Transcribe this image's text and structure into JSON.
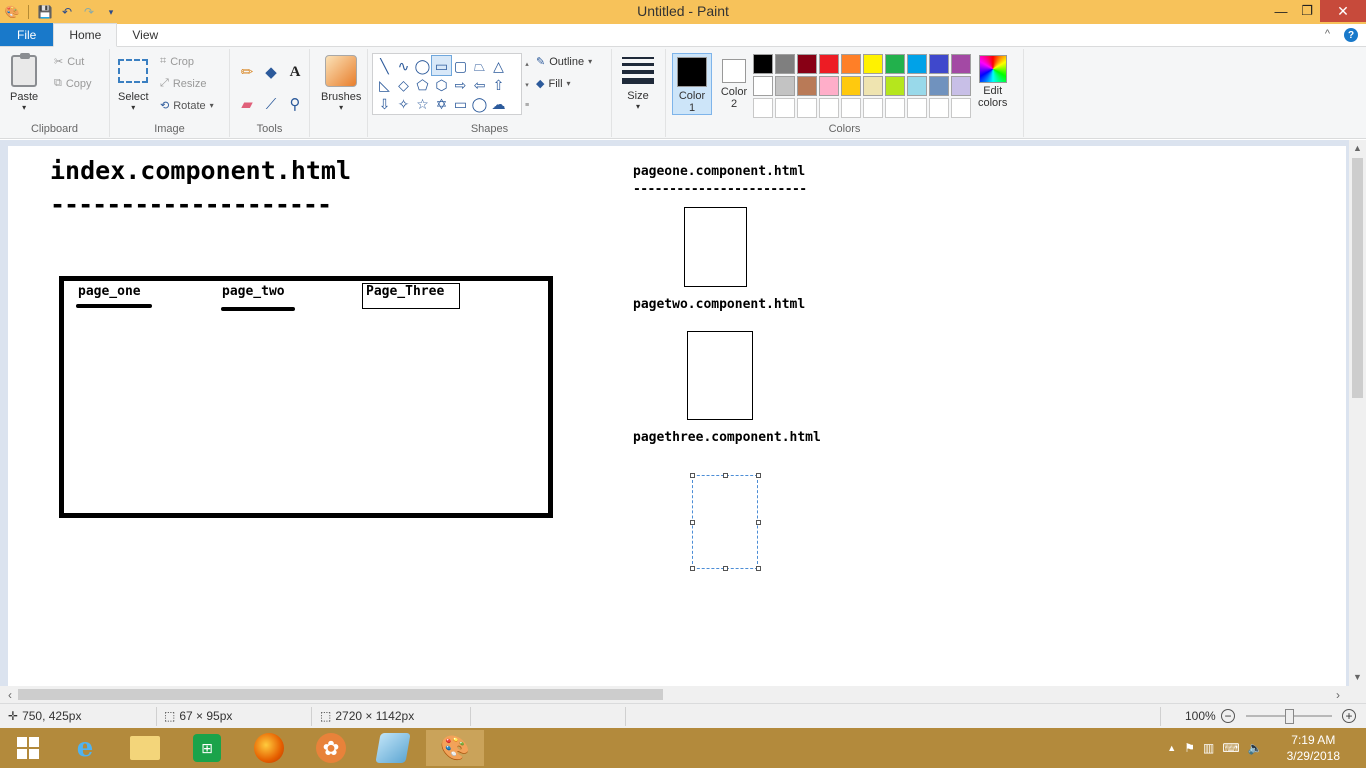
{
  "window": {
    "title": "Untitled - Paint",
    "minimize": "—",
    "maximize": "❐",
    "close": "✕"
  },
  "tabs": {
    "file": "File",
    "home": "Home",
    "view": "View",
    "collapse": "^",
    "help": "?"
  },
  "ribbon": {
    "clipboard": {
      "label": "Clipboard",
      "paste": "Paste",
      "cut": "Cut",
      "copy": "Copy"
    },
    "image": {
      "label": "Image",
      "select": "Select",
      "crop": "Crop",
      "resize": "Resize",
      "rotate": "Rotate"
    },
    "tools": {
      "label": "Tools"
    },
    "brushes": "Brushes",
    "shapes": {
      "label": "Shapes",
      "outline": "Outline",
      "fill": "Fill"
    },
    "size": "Size",
    "colors": {
      "label": "Colors",
      "color1": "Color",
      "color1_num": "1",
      "color2": "Color",
      "color2_num": "2",
      "edit_line1": "Edit",
      "edit_line2": "colors",
      "color1_value": "#000000",
      "color2_value": "#ffffff",
      "palette": [
        "#000000",
        "#7f7f7f",
        "#880015",
        "#ed1c24",
        "#ff7f27",
        "#fff200",
        "#22b14c",
        "#00a2e8",
        "#3f48cc",
        "#a349a4",
        "#ffffff",
        "#c3c3c3",
        "#b97a57",
        "#ffaec9",
        "#ffc90e",
        "#efe4b0",
        "#b5e61d",
        "#99d9ea",
        "#7092be",
        "#c8bfe7",
        "#ffffff",
        "#ffffff",
        "#ffffff",
        "#ffffff",
        "#ffffff",
        "#ffffff",
        "#ffffff",
        "#ffffff",
        "#ffffff",
        "#ffffff"
      ]
    }
  },
  "canvas": {
    "index_title": "index.component.html",
    "index_dashes": "--------------------",
    "page_one_link": "page_one",
    "page_two_link": "page_two",
    "page_three_link": "Page_Three",
    "pageone_label": "pageone.component.html",
    "pageone_dashes": "------------------------",
    "pagetwo_label": "pagetwo.component.html",
    "pagethree_label": "pagethree.component.html"
  },
  "status": {
    "cursor_pos": "750, 425px",
    "selection_size": "67 × 95px",
    "image_size": "2720 × 1142px",
    "zoom": "100%",
    "zoom_out": "−",
    "zoom_in": "+"
  },
  "taskbar": {
    "time": "7:19 AM",
    "date": "3/29/2018"
  }
}
